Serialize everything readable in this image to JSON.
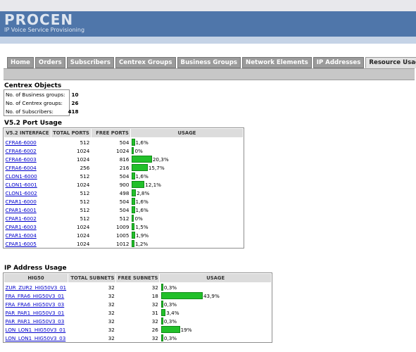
{
  "app": {
    "logo": "PROCEN",
    "tagline": "IP Voice Service Provisioning"
  },
  "tabs": [
    "Home",
    "Orders",
    "Subscribers",
    "Centrex Groups",
    "Business Groups",
    "Network Elements",
    "IP Addresses",
    "Resource Usage"
  ],
  "active_tab": "Resource Usage",
  "centrex": {
    "title": "Centrex Objects",
    "rows": [
      {
        "label": "No. of Business groups:",
        "value": "10"
      },
      {
        "label": "No. of Centrex groups:",
        "value": "26"
      },
      {
        "label": "No. of Subscribers:",
        "value": "418"
      }
    ]
  },
  "v52": {
    "title": "V5.2 Port Usage",
    "headers": [
      "V5.2 INTERFACE",
      "TOTAL PORTS",
      "FREE PORTS",
      "USAGE"
    ],
    "rows": [
      {
        "name": "CFRA6-6000",
        "total": "512",
        "free": "504",
        "usage": "1,6%",
        "pct": 1.6
      },
      {
        "name": "CFRA6-6002",
        "total": "1024",
        "free": "1024",
        "usage": "0%",
        "pct": 0
      },
      {
        "name": "CFRA6-6003",
        "total": "1024",
        "free": "816",
        "usage": "20,3%",
        "pct": 20.3
      },
      {
        "name": "CFRA6-6004",
        "total": "256",
        "free": "216",
        "usage": "15,7%",
        "pct": 15.7
      },
      {
        "name": "CLON1-6000",
        "total": "512",
        "free": "504",
        "usage": "1,6%",
        "pct": 1.6
      },
      {
        "name": "CLON1-6001",
        "total": "1024",
        "free": "900",
        "usage": "12,1%",
        "pct": 12.1
      },
      {
        "name": "CLON1-6002",
        "total": "512",
        "free": "498",
        "usage": "2,8%",
        "pct": 2.8
      },
      {
        "name": "CPAR1-6000",
        "total": "512",
        "free": "504",
        "usage": "1,6%",
        "pct": 1.6
      },
      {
        "name": "CPAR1-6001",
        "total": "512",
        "free": "504",
        "usage": "1,6%",
        "pct": 1.6
      },
      {
        "name": "CPAR1-6002",
        "total": "512",
        "free": "512",
        "usage": "0%",
        "pct": 0
      },
      {
        "name": "CPAR1-6003",
        "total": "1024",
        "free": "1009",
        "usage": "1,5%",
        "pct": 1.5
      },
      {
        "name": "CPAR1-6004",
        "total": "1024",
        "free": "1005",
        "usage": "1,9%",
        "pct": 1.9
      },
      {
        "name": "CPAR1-6005",
        "total": "1024",
        "free": "1012",
        "usage": "1,2%",
        "pct": 1.2
      }
    ]
  },
  "ip": {
    "title": "IP Address Usage",
    "headers": [
      "HIG50",
      "TOTAL SUBNETS",
      "FREE SUBNETS",
      "USAGE"
    ],
    "rows": [
      {
        "name": "ZUR_ZUR2_HIG50V3_01",
        "total": "32",
        "free": "32",
        "usage": "0,3%",
        "pct": 0.3
      },
      {
        "name": "FRA_FRA6_HIG50V3_01",
        "total": "32",
        "free": "18",
        "usage": "43,9%",
        "pct": 43.9
      },
      {
        "name": "FRA_FRA6_HIG50V3_03",
        "total": "32",
        "free": "32",
        "usage": "0,3%",
        "pct": 0.3
      },
      {
        "name": "PAR_PAR1_HIG50V3_01",
        "total": "32",
        "free": "31",
        "usage": "3,4%",
        "pct": 3.4
      },
      {
        "name": "PAR_PAR1_HIG50V3_03",
        "total": "32",
        "free": "32",
        "usage": "0,3%",
        "pct": 0.3
      },
      {
        "name": "LON_LON1_HIG50V3_01",
        "total": "32",
        "free": "26",
        "usage": "19%",
        "pct": 19
      },
      {
        "name": "LON_LON1_HIG50V3_03",
        "total": "32",
        "free": "32",
        "usage": "0,3%",
        "pct": 0.3
      }
    ]
  },
  "colors": {
    "header": "#4f76aa",
    "bar": "#22c02a",
    "link": "#0000cc"
  }
}
